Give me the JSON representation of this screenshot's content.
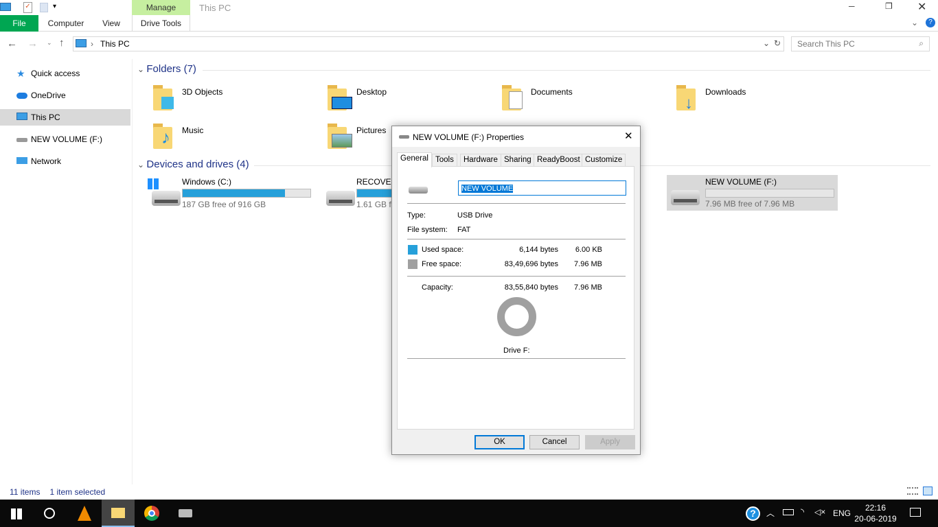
{
  "window": {
    "title": "This PC",
    "ribbon_context": "Manage",
    "tabs": [
      "File",
      "Computer",
      "View",
      "Drive Tools"
    ]
  },
  "address": {
    "path": "This PC",
    "search_placeholder": "Search This PC"
  },
  "nav": [
    {
      "label": "Quick access",
      "icon": "star-icon"
    },
    {
      "label": "OneDrive",
      "icon": "cloud-icon"
    },
    {
      "label": "This PC",
      "icon": "computer-icon",
      "selected": true
    },
    {
      "label": "NEW VOLUME (F:)",
      "icon": "usb-drive-icon"
    },
    {
      "label": "Network",
      "icon": "network-icon"
    }
  ],
  "folders": {
    "header": "Folders (7)",
    "items": [
      "3D Objects",
      "Desktop",
      "Documents",
      "Downloads",
      "Music",
      "Pictures"
    ]
  },
  "devices": {
    "header": "Devices and drives (4)",
    "items": [
      {
        "label": "Windows (C:)",
        "sub": "187 GB free of 916 GB",
        "used_pct": 80
      },
      {
        "label": "RECOVERY",
        "sub": "1.61 GB free",
        "used_pct": 75
      },
      {
        "label": "NEW VOLUME (F:)",
        "sub": "7.96 MB free of 7.96 MB",
        "used_pct": 0,
        "selected": true
      }
    ]
  },
  "status": {
    "items": "11 items",
    "selected": "1 item selected"
  },
  "dialog": {
    "title": "NEW VOLUME (F:) Properties",
    "tabs": [
      "General",
      "Tools",
      "Hardware",
      "Sharing",
      "ReadyBoost",
      "Customize"
    ],
    "name_value": "NEW VOLUME",
    "type_label": "Type:",
    "type_value": "USB Drive",
    "fs_label": "File system:",
    "fs_value": "FAT",
    "used_label": "Used space:",
    "used_bytes": "6,144 bytes",
    "used_size": "6.00 KB",
    "free_label": "Free space:",
    "free_bytes": "83,49,696 bytes",
    "free_size": "7.96 MB",
    "cap_label": "Capacity:",
    "cap_bytes": "83,55,840 bytes",
    "cap_size": "7.96 MB",
    "drive_label": "Drive F:",
    "ok": "OK",
    "cancel": "Cancel",
    "apply": "Apply",
    "used_color": "#26a0da",
    "free_color": "#a0a0a0"
  },
  "taskbar": {
    "lang": "ENG",
    "time": "22:16",
    "date": "20-06-2019"
  }
}
